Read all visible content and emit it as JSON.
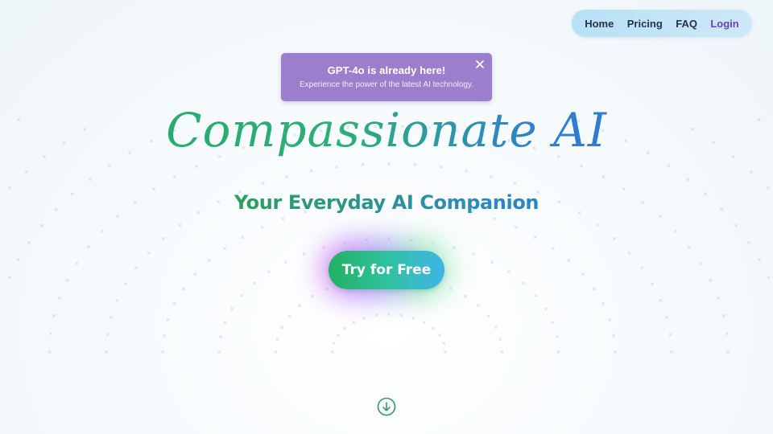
{
  "nav": {
    "items": [
      {
        "label": "Home"
      },
      {
        "label": "Pricing"
      },
      {
        "label": "FAQ"
      },
      {
        "label": "Login"
      }
    ]
  },
  "banner": {
    "title": "GPT-4o is already here!",
    "subtitle": "Experience the power of the latest AI technology.",
    "close_icon": "close-icon"
  },
  "hero": {
    "title": "Compassionate AI",
    "subtitle": "Your Everyday AI Companion",
    "cta_label": "Try for Free"
  },
  "scroll": {
    "icon": "arrow-down-circle-icon"
  },
  "colors": {
    "accent_green": "#22b061",
    "accent_blue": "#3a6fd8",
    "banner_purple": "#9b7fcc",
    "login_purple": "#6b3fb8",
    "nav_bg": "#c4e4f6"
  }
}
